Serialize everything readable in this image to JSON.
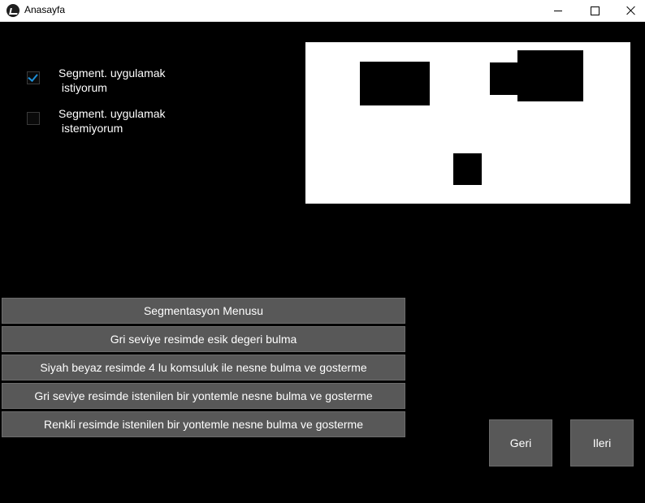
{
  "window": {
    "title": "Anasayfa"
  },
  "checkboxes": [
    {
      "label": "Segment. uygulamak\n istiyorum",
      "checked": true
    },
    {
      "label": "Segment. uygulamak\n istemiyorum",
      "checked": false
    }
  ],
  "preview": {
    "description_icon": "segmented-image-preview"
  },
  "menu": {
    "items": [
      "Segmentasyon Menusu",
      "Gri seviye resimde esik degeri bulma",
      "Siyah beyaz resimde 4 lu komsuluk ile nesne bulma ve gosterme",
      "Gri seviye resimde istenilen bir yontemle nesne bulma ve gosterme",
      "Renkli resimde istenilen bir yontemle nesne bulma ve gosterme"
    ]
  },
  "nav": {
    "back": "Geri",
    "next": "Ileri"
  },
  "colors": {
    "background": "#000000",
    "button": "#585858",
    "check_accent": "#1e90d8"
  }
}
